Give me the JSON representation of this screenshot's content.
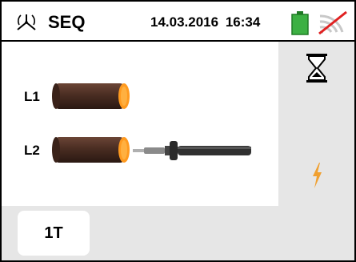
{
  "header": {
    "mode_label": "SEQ",
    "date": "14.03.2016",
    "time": "16:34",
    "battery_icon": "battery-full-icon",
    "wireless_icon": "wireless-disabled-icon",
    "mode_icon": "three-phase-sequence-icon"
  },
  "diagram": {
    "l1_label": "L1",
    "l2_label": "L2"
  },
  "side_panel": {
    "status_icon": "hourglass-icon",
    "indicator_icon": "lightning-bolt-icon"
  },
  "softkeys": {
    "mode_key_label": "1T"
  },
  "colors": {
    "battery_green": "#3cb043",
    "wireless_red": "#e02020",
    "cable_brown": "#4a2d22",
    "cable_tip_orange": "#ff9a1f",
    "bolt_orange": "#f0a030"
  }
}
